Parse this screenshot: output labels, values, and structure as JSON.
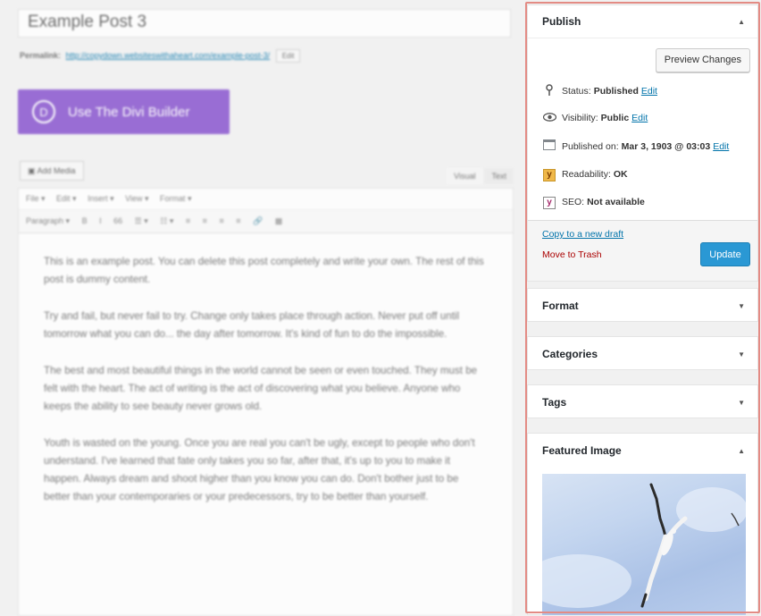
{
  "editor": {
    "post_title": "Example Post 3",
    "permalink_label": "Permalink:",
    "permalink_url": "http://copydown.websiteswithaheart.com/example-post-3/",
    "permalink_edit": "Edit",
    "divi_icon": "D",
    "divi_button": "Use The Divi Builder",
    "add_media": "Add Media",
    "tab_visual": "Visual",
    "tab_text": "Text",
    "menus": [
      "File ▾",
      "Edit ▾",
      "Insert ▾",
      "View ▾",
      "Format ▾"
    ],
    "format_items": [
      "Paragraph ▾",
      "B",
      "I",
      "66",
      "☰ ▾",
      "☷ ▾",
      "≡",
      "≡",
      "≡",
      "≡",
      "🔗",
      "▦"
    ],
    "paragraphs": [
      "This is an example post. You can delete this post completely and write your own. The rest of this post is dummy content.",
      "Try and fail, but never fail to try. Change only takes place through action. Never put off until tomorrow what you can do... the day after tomorrow. It's kind of fun to do the impossible.",
      "The best and most beautiful things in the world cannot be seen or even touched. They must be felt with the heart. The act of writing is the act of discovering what you believe. Anyone who keeps the ability to see beauty never grows old.",
      "Youth is wasted on the young. Once you are real you can't be ugly, except to people who don't understand. I've learned that fate only takes you so far, after that, it's up to you to make it happen. Always dream and shoot higher than you know you can do. Don't bother just to be better than your contemporaries or your predecessors, try to be better than yourself."
    ]
  },
  "publish": {
    "title": "Publish",
    "preview_button": "Preview Changes",
    "status_label": "Status:",
    "status_value": "Published",
    "visibility_label": "Visibility:",
    "visibility_value": "Public",
    "published_label": "Published on:",
    "published_value": "Mar 3, 1903 @ 03:03",
    "readability_label": "Readability:",
    "readability_value": "OK",
    "seo_label": "SEO:",
    "seo_value": "Not available",
    "edit_link": "Edit",
    "copy_draft": "Copy to a new draft",
    "move_trash": "Move to Trash",
    "update_button": "Update"
  },
  "boxes": {
    "format": "Format",
    "categories": "Categories",
    "tags": "Tags",
    "featured_image": "Featured Image"
  },
  "icons": {
    "status": "pin-icon",
    "visibility": "eye-icon",
    "published": "calendar-icon",
    "readability": "yoast-icon",
    "seo": "yoast-icon",
    "collapse": "chevron-up-icon",
    "expand": "chevron-down-icon"
  },
  "colors": {
    "divi_purple": "#8a57cf",
    "update_blue": "#2a98d4",
    "highlight_border": "#e38b84",
    "link_blue": "#0073aa",
    "trash_red": "#aa0000"
  }
}
